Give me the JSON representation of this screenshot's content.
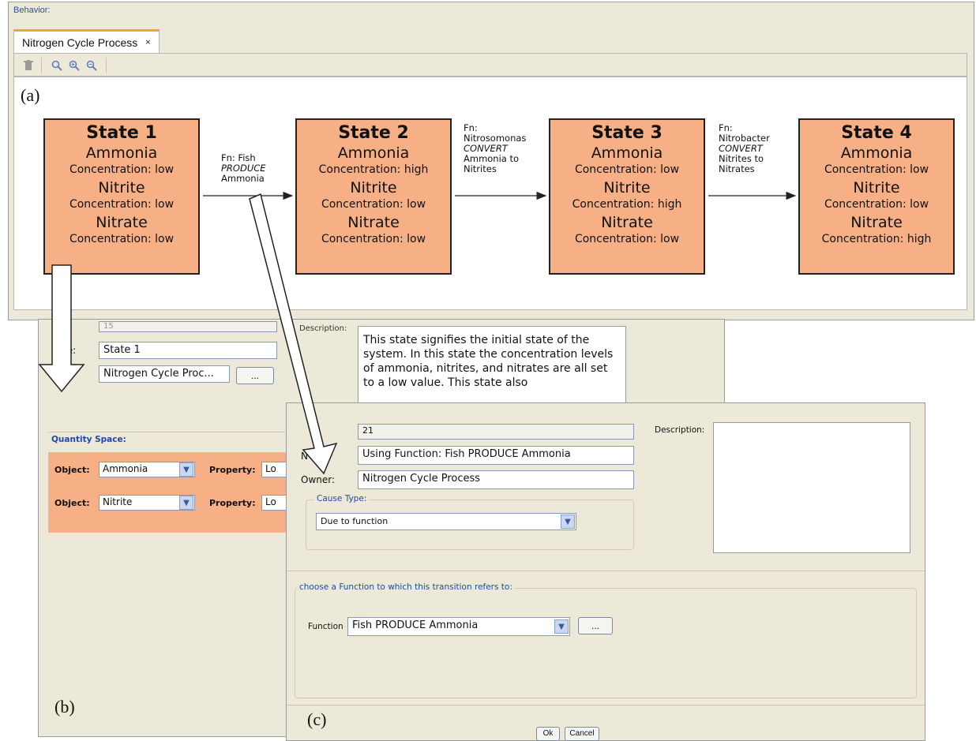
{
  "panel_a": {
    "behavior_label": "Behavior:",
    "tab": {
      "label": "Nitrogen Cycle Process",
      "close": "×"
    },
    "toolbar": {
      "delete_icon": "trash-icon",
      "zoom_icons": [
        "zoom-icon",
        "zoom-in-icon",
        "zoom-out-icon"
      ]
    },
    "figure_label": "(a)",
    "states": [
      {
        "title": "State 1",
        "items": [
          {
            "name": "Ammonia",
            "conc": "Concentration: low"
          },
          {
            "name": "Nitrite",
            "conc": "Concentration: low"
          },
          {
            "name": "Nitrate",
            "conc": "Concentration: low"
          }
        ]
      },
      {
        "title": "State 2",
        "items": [
          {
            "name": "Ammonia",
            "conc": "Concentration: high"
          },
          {
            "name": "Nitrite",
            "conc": "Concentration: low"
          },
          {
            "name": "Nitrate",
            "conc": "Concentration: low"
          }
        ]
      },
      {
        "title": "State 3",
        "items": [
          {
            "name": "Ammonia",
            "conc": "Concentration: low"
          },
          {
            "name": "Nitrite",
            "conc": "Concentration: high"
          },
          {
            "name": "Nitrate",
            "conc": "Concentration: low"
          }
        ]
      },
      {
        "title": "State 4",
        "items": [
          {
            "name": "Ammonia",
            "conc": "Concentration: low"
          },
          {
            "name": "Nitrite",
            "conc": "Concentration: low"
          },
          {
            "name": "Nitrate",
            "conc": "Concentration: high"
          }
        ]
      }
    ],
    "transitions": [
      {
        "lines": [
          "Fn: Fish",
          "PRODUCE",
          "Ammonia"
        ]
      },
      {
        "lines": [
          "Fn:",
          "Nitrosomonas",
          "CONVERT",
          "Ammonia to",
          "Nitrites"
        ]
      },
      {
        "lines": [
          "Fn:",
          "Nitrobacter",
          "CONVERT",
          "Nitrites to",
          "Nitrates"
        ]
      }
    ]
  },
  "panel_b": {
    "figure_label": "(b)",
    "id_value": "15",
    "name_label": "me:",
    "name_value": "State 1",
    "owner_label": "er:",
    "owner_value": "Nitrogen Cycle Proc...",
    "owner_button": "...",
    "description_label": "Description:",
    "description_text": "This state signifies the initial state of the system. In this state the concentration levels of ammonia, nitrites, and nitrates are all set to a low value. This state also",
    "quantity_space_label": "Quantity Space:",
    "rows": [
      {
        "object_label": "Object:",
        "object_value": "Ammonia",
        "property_label": "Property:",
        "property_value": "Lo"
      },
      {
        "object_label": "Object:",
        "object_value": "Nitrite",
        "property_label": "Property:",
        "property_value": "Lo"
      }
    ]
  },
  "panel_c": {
    "figure_label": "(c)",
    "id_value": "21",
    "name_label": "N",
    "name_value": "Using Function: Fish PRODUCE Ammonia",
    "owner_label": "Owner:",
    "owner_value": "Nitrogen Cycle Process",
    "description_label": "Description:",
    "cause_type_legend": "Cause Type:",
    "cause_type_value": "Due to function",
    "function_group_legend": "choose a Function to which this transition refers to:",
    "function_label": "Function",
    "function_value": "Fish PRODUCE Ammonia",
    "function_button": "...",
    "ok": "Ok",
    "cancel": "Cancel"
  }
}
